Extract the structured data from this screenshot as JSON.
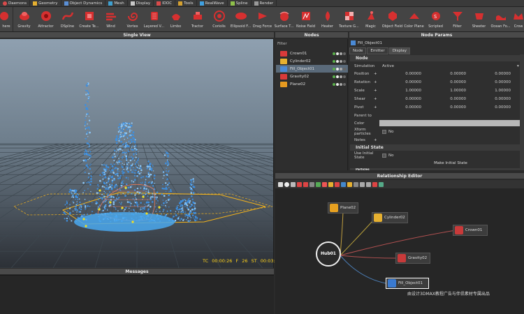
{
  "tabs": [
    {
      "label": "Daemons",
      "color": "#d94a4a"
    },
    {
      "label": "Geometry",
      "color": "#e6b030"
    },
    {
      "label": "Object Dynamics",
      "color": "#5a8fd6"
    },
    {
      "label": "Mesh",
      "color": "#3fa0d0"
    },
    {
      "label": "Display",
      "color": "#c8c8c8"
    },
    {
      "label": "IDOC",
      "color": "#d94a4a"
    },
    {
      "label": "Tools",
      "color": "#d4a030"
    },
    {
      "label": "RealWave",
      "color": "#40a0e0"
    },
    {
      "label": "Spline",
      "color": "#8fc04a"
    },
    {
      "label": "Render",
      "color": "#999999"
    }
  ],
  "toolbar": [
    "here",
    "Gravity",
    "Attractor",
    "DSpline",
    "Create Te...",
    "Wind",
    "Vortex",
    "Layered V...",
    "Limbo",
    "Tractor",
    "Coriolis",
    "Ellipsoid F...",
    "Drag Force",
    "Surface T...",
    "Noise Field",
    "Heater",
    "Texture G...",
    "Magic",
    "Object Field",
    "Color Plane",
    "Scripted",
    "Filter",
    "Sheeter",
    "Ocean Fo...",
    "Crow"
  ],
  "panels": {
    "viewport_title": "Single View",
    "nodes_title": "Nodes",
    "params_title": "Node Params",
    "relationship_title": "Relationship Editor",
    "messages_title": "Messages"
  },
  "viewport": {
    "timecode": "TC 00:00:26   F 26   ST 00:03:24"
  },
  "nodes": {
    "filter_label": "Filter",
    "items": [
      {
        "label": "Crown01",
        "color": "#d93a3a"
      },
      {
        "label": "Cylinder02",
        "color": "#e6b030"
      },
      {
        "label": "Fill_Object01",
        "color": "#4a8ad6"
      },
      {
        "label": "Gravity02",
        "color": "#d93a3a"
      },
      {
        "label": "Plane02",
        "color": "#e69a20"
      }
    ]
  },
  "params": {
    "object_name": "Fill_Object01",
    "tabs": [
      "Node",
      "Emitter",
      "Display"
    ],
    "section_node": "Node",
    "simulation_label": "Simulation",
    "simulation_value": "Active",
    "rows": [
      {
        "label": "Position",
        "v1": "0.00000",
        "v2": "0.00000",
        "v3": "0.00000"
      },
      {
        "label": "Rotation",
        "v1": "0.00000",
        "v2": "0.00000",
        "v3": "0.00000"
      },
      {
        "label": "Scale",
        "v1": "1.00000",
        "v2": "1.00000",
        "v3": "1.00000"
      },
      {
        "label": "Shear",
        "v1": "0.00000",
        "v2": "0.00000",
        "v3": "0.00000"
      },
      {
        "label": "Pivot",
        "v1": "0.00000",
        "v2": "0.00000",
        "v3": "0.00000"
      }
    ],
    "parent_label": "Parent to",
    "color_label": "Color",
    "xform_label": "Xform particles",
    "xform_value": "No",
    "notes_label": "Notes",
    "section_initial": "Initial State",
    "use_initial_label": "Use Initial State",
    "use_initial_value": "No",
    "make_initial": "Make Initial State",
    "section_particles": "Particles"
  },
  "relationship": {
    "hub": "Hub01",
    "nodes": [
      {
        "label": "Plane02",
        "color": "#e6a020"
      },
      {
        "label": "Cylinder02",
        "color": "#e6b030"
      },
      {
        "label": "Crown01",
        "color": "#c83a3a"
      },
      {
        "label": "Gravity02",
        "color": "#c83a3a"
      },
      {
        "label": "Fill_Object01",
        "color": "#3a7ad0"
      }
    ]
  },
  "watermark": "由设计3DMAX教程广告与伴侣素材专属出品"
}
